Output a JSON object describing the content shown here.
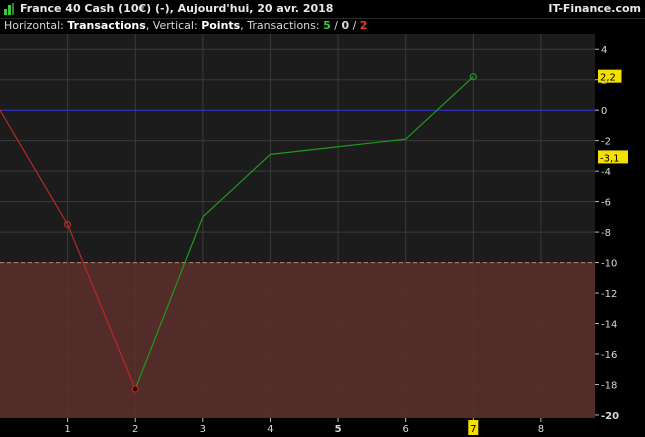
{
  "header": {
    "title": "France 40 Cash (10€) (-), Aujourd'hui, 20 avr. 2018",
    "brand": "IT-Finance.com"
  },
  "subtitle": {
    "horizontal_label": "Horizontal: ",
    "horizontal_value": "Transactions",
    "vertical_label": ", Vertical: ",
    "vertical_value": "Points",
    "transactions_label": ", Transactions: ",
    "wins": "5",
    "sep1": " / ",
    "flat": "0",
    "sep2": " / ",
    "losses": "2"
  },
  "colors": {
    "background": "#000000",
    "panel": "#1c1c1c",
    "grid": "#3a3a3a",
    "zero_line": "#3030d0",
    "gain_line": "#1e9a1e",
    "loss_line": "#b82828",
    "drawdown_fill": "#5a2e2a",
    "drawdown_line": "#c08070",
    "highlight": "#f5e000"
  },
  "chart_data": {
    "type": "line",
    "x": [
      0,
      1,
      2,
      3,
      4,
      5,
      6,
      7
    ],
    "y": [
      0,
      -7.5,
      -18.3,
      -7.0,
      -2.9,
      -2.4,
      -1.9,
      2.2
    ],
    "segments": [
      {
        "from": 0,
        "to": 1,
        "color": "loss"
      },
      {
        "from": 1,
        "to": 2,
        "color": "loss"
      },
      {
        "from": 2,
        "to": 3,
        "color": "gain"
      },
      {
        "from": 3,
        "to": 4,
        "color": "gain"
      },
      {
        "from": 4,
        "to": 5,
        "color": "gain"
      },
      {
        "from": 5,
        "to": 6,
        "color": "gain"
      },
      {
        "from": 6,
        "to": 7,
        "color": "gain"
      }
    ],
    "markers": [
      {
        "x": 1,
        "y": -7.5,
        "color": "loss",
        "fill": "none"
      },
      {
        "x": 2,
        "y": -18.3,
        "color": "loss",
        "fill": "dark"
      },
      {
        "x": 7,
        "y": 2.2,
        "color": "gain",
        "fill": "none"
      }
    ],
    "xticks": [
      "1",
      "2",
      "3",
      "4",
      "5",
      "6",
      "7",
      "8"
    ],
    "xlim": [
      0,
      8.8
    ],
    "highlighted_xtick": "7",
    "bold_xtick": "5",
    "yticks": [
      "4",
      "2",
      "0",
      "-2",
      "-4",
      "-6",
      "-8",
      "-10",
      "-12",
      "-14",
      "-16",
      "-18",
      "-20"
    ],
    "ytick_values": [
      4,
      2,
      0,
      -2,
      -4,
      -6,
      -8,
      -10,
      -12,
      -14,
      -16,
      -18,
      -20
    ],
    "bold_ytick": "-20",
    "ylim": [
      -20.2,
      5
    ],
    "zero_line": 0,
    "drawdown_threshold": -10,
    "value_labels": [
      {
        "text": "2,2",
        "value": 2.2
      },
      {
        "text": "-3,1",
        "value": -3.1
      }
    ],
    "grid": true
  }
}
